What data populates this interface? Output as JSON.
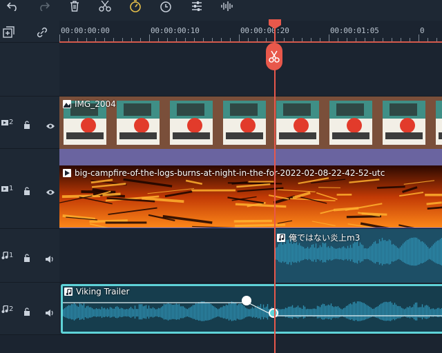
{
  "toolbar": {
    "icons": [
      "undo-icon",
      "redo-icon",
      "delete-icon",
      "cut-icon",
      "speed-icon",
      "duration-icon",
      "adjust-icon",
      "audio-icon"
    ]
  },
  "left_tools": [
    "add-track-icon",
    "link-icon"
  ],
  "ruler": {
    "timecodes": [
      "00:00:00:00",
      "00:00:00:10",
      "00:00:00:20",
      "00:00:01:05",
      "0"
    ]
  },
  "tracks": [
    {
      "kind": "video",
      "number": "2"
    },
    {
      "kind": "video",
      "number": "1"
    },
    {
      "kind": "audio",
      "number": "1"
    },
    {
      "kind": "audio",
      "number": "2"
    }
  ],
  "clips": {
    "image_clip": "IMG_2004",
    "video_clip": "big-campfire-of-the-logs-burns-at-night-in-the-for-2022-02-08-22-42-52-utc",
    "audio_clip_1": "俺ではない炎上m3",
    "audio_clip_2": "Viking Trailer"
  },
  "colors": {
    "accent": "#e8584b",
    "selected_clip": "#5fd3d8",
    "audio_wave": "#2e8fb0"
  }
}
